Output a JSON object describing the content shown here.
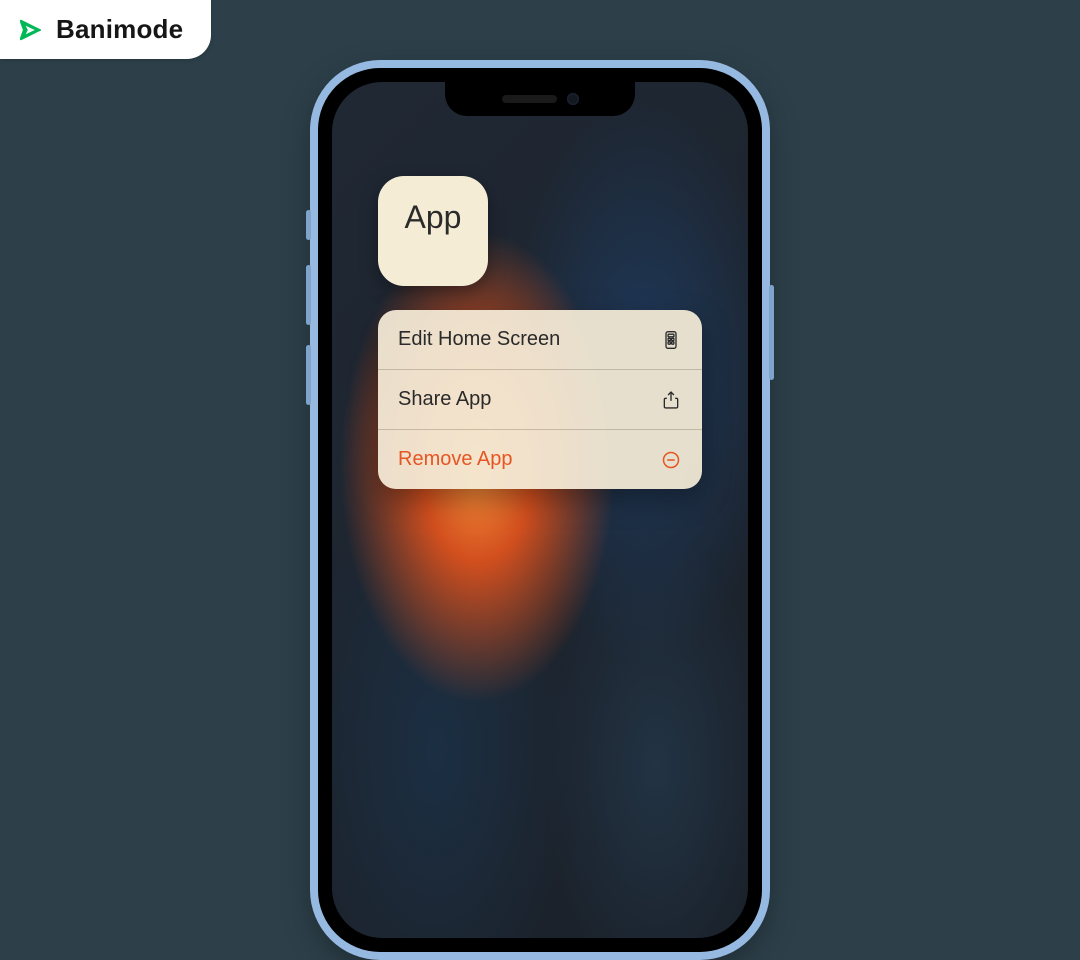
{
  "brand": {
    "name": "Banimode"
  },
  "app_icon": {
    "label": "App"
  },
  "menu": {
    "items": [
      {
        "label": "Edit Home Screen"
      },
      {
        "label": "Share App"
      },
      {
        "label": "Remove App"
      }
    ]
  },
  "colors": {
    "destructive": "#e65522",
    "accent": "#00b956"
  }
}
